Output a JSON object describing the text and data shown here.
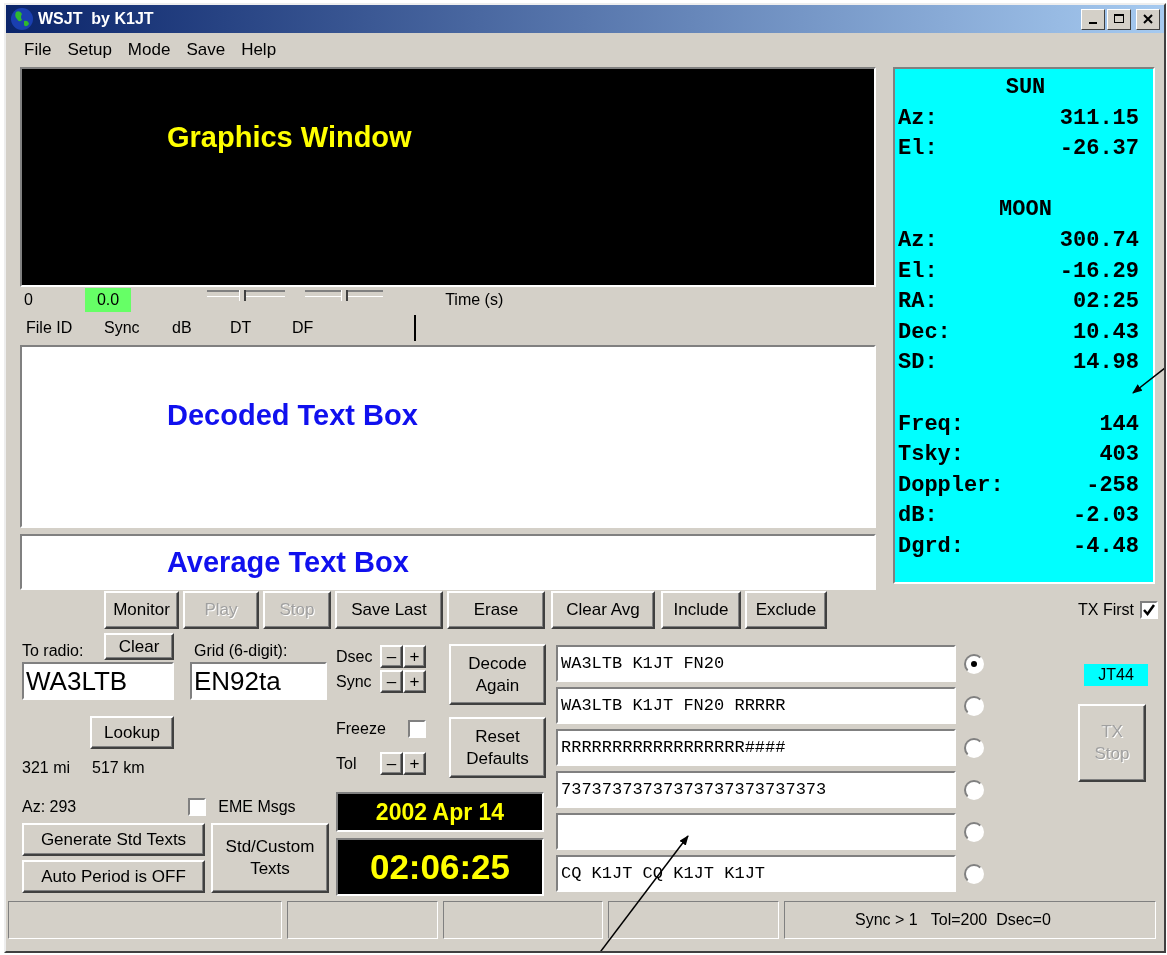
{
  "window": {
    "title": "WSJT  by K1JT"
  },
  "menu": [
    "File",
    "Setup",
    "Mode",
    "Save",
    "Help"
  ],
  "graphics": {
    "label": "Graphics Window"
  },
  "scale": {
    "start": "0",
    "value": "0.0",
    "axis_label": "Time (s)"
  },
  "sliders": [
    {
      "level": 0.45
    },
    {
      "level": 0.5
    }
  ],
  "columns": [
    "File ID",
    "Sync",
    "dB",
    "DT",
    "DF"
  ],
  "decoded_box": {
    "label": "Decoded Text Box"
  },
  "average_box": {
    "label": "Average Text Box"
  },
  "buttons": [
    {
      "label": "Monitor",
      "disabled": false
    },
    {
      "label": "Play",
      "disabled": true
    },
    {
      "label": "Stop",
      "disabled": true
    },
    {
      "label": "Save Last",
      "disabled": false
    },
    {
      "label": "Erase",
      "disabled": false
    },
    {
      "label": "Clear Avg",
      "disabled": false
    },
    {
      "label": "Include",
      "disabled": false
    },
    {
      "label": "Exclude",
      "disabled": false
    }
  ],
  "tx_first": {
    "label": "TX First",
    "checked": true
  },
  "to_radio": {
    "label": "To radio:",
    "value": "WA3LTB",
    "clear": "Clear"
  },
  "grid": {
    "label": "Grid (6-digit):",
    "value": "EN92ta"
  },
  "lookup": "Lookup",
  "distance_mi": "321 mi",
  "distance_km": "517 km",
  "azimuth": "Az: 293",
  "eme_msgs": {
    "label": "EME Msgs",
    "checked": false
  },
  "generate": "Generate Std Texts",
  "auto_period": "Auto Period is OFF",
  "std_custom": "Std/Custom Texts",
  "steppers": [
    {
      "label": "Dsec",
      "decrement": "–",
      "increment": "+"
    },
    {
      "label": "Sync",
      "decrement": "–",
      "increment": "+"
    }
  ],
  "freeze": {
    "label": "Freeze",
    "checked": false
  },
  "tol": {
    "label": "Tol",
    "decrement": "–",
    "increment": "+"
  },
  "decode_again": "Decode Again",
  "reset_defaults": "Reset Defaults",
  "date": "2002 Apr 14",
  "time": "02:06:25",
  "messages": [
    {
      "text": "WA3LTB K1JT FN20",
      "selected": true
    },
    {
      "text": "WA3LTB K1JT FN20 RRRRR",
      "selected": false
    },
    {
      "text": "RRRRRRRRRRRRRRRRRR####",
      "selected": false
    },
    {
      "text": "73737373737373737373737373",
      "selected": false
    },
    {
      "selected": false
    },
    {
      "text": "CQ K1JT CQ K1JT K1JT",
      "selected": false
    }
  ],
  "mode_badge": "JT44",
  "tx_stop": {
    "label": "TX Stop",
    "disabled": true
  },
  "astro": [
    {
      "title": "SUN",
      "rows": [
        {
          "label": "Az:",
          "value": "311.15"
        },
        {
          "label": "El:",
          "value": "-26.37"
        }
      ]
    },
    {
      "title": "MOON",
      "rows": [
        {
          "label": "Az:",
          "value": "300.74"
        },
        {
          "label": "El:",
          "value": "-16.29"
        },
        {
          "label": "RA:",
          "value": "02:25"
        },
        {
          "label": "Dec:",
          "value": "10.43"
        },
        {
          "label": "SD:",
          "value": "14.98"
        }
      ]
    },
    {
      "rows": [
        {
          "label": "Freq:",
          "value": "144"
        },
        {
          "label": "Tsky:",
          "value": "403"
        },
        {
          "label": "Doppler:",
          "value": "-258"
        },
        {
          "label": "dB:",
          "value": "-2.03"
        },
        {
          "label": "Dgrd:",
          "value": "-4.48"
        }
      ]
    }
  ],
  "status_bar": {
    "text": "Sync > 1   Tol=200  Dsec=0"
  }
}
